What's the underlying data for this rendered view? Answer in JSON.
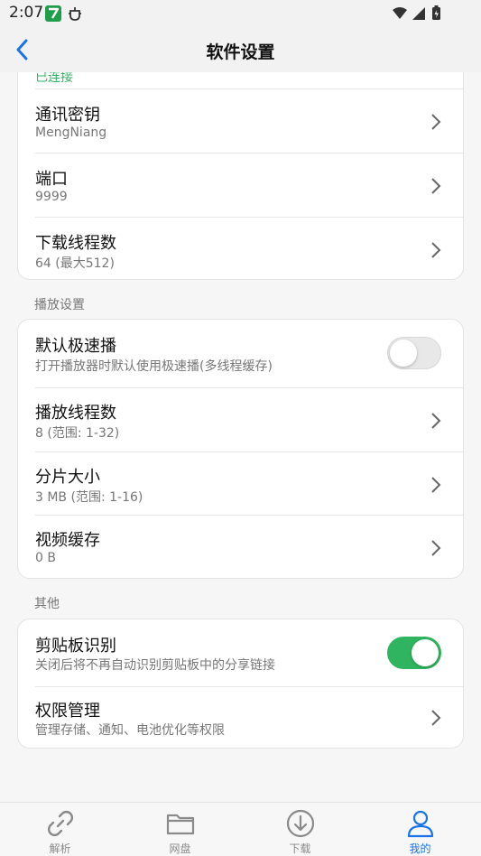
{
  "status_bar": {
    "time": "2:07"
  },
  "header": {
    "title": "软件设置"
  },
  "cards": {
    "network": {
      "partial_text": "已连接",
      "rows": [
        {
          "title": "通讯密钥",
          "subtitle": "MengNiang"
        },
        {
          "title": "端口",
          "subtitle": "9999"
        },
        {
          "title": "下载线程数",
          "subtitle": "64 (最大512)"
        }
      ]
    },
    "playback": {
      "section_label": "播放设置",
      "rows": [
        {
          "title": "默认极速播",
          "subtitle": "打开播放器时默认使用极速播(多线程缓存)",
          "toggle": false
        },
        {
          "title": "播放线程数",
          "subtitle": "8 (范围: 1-32)"
        },
        {
          "title": "分片大小",
          "subtitle": "3 MB (范围: 1-16)"
        },
        {
          "title": "视频缓存",
          "subtitle": "0 B"
        }
      ]
    },
    "other": {
      "section_label": "其他",
      "rows": [
        {
          "title": "剪贴板识别",
          "subtitle": "关闭后将不再自动识别剪贴板中的分享链接",
          "toggle": true
        },
        {
          "title": "权限管理",
          "subtitle": "管理存储、通知、电池优化等权限"
        }
      ]
    }
  },
  "tabbar": {
    "tabs": [
      {
        "label": "解析",
        "icon": "link-icon",
        "active": false
      },
      {
        "label": "网盘",
        "icon": "folder-icon",
        "active": false
      },
      {
        "label": "下载",
        "icon": "download-icon",
        "active": false
      },
      {
        "label": "我的",
        "icon": "user-icon",
        "active": true
      }
    ]
  },
  "colors": {
    "accent": "#1a73e8",
    "toggle_on": "#2fb55f",
    "status_green": "#2fb55f"
  }
}
